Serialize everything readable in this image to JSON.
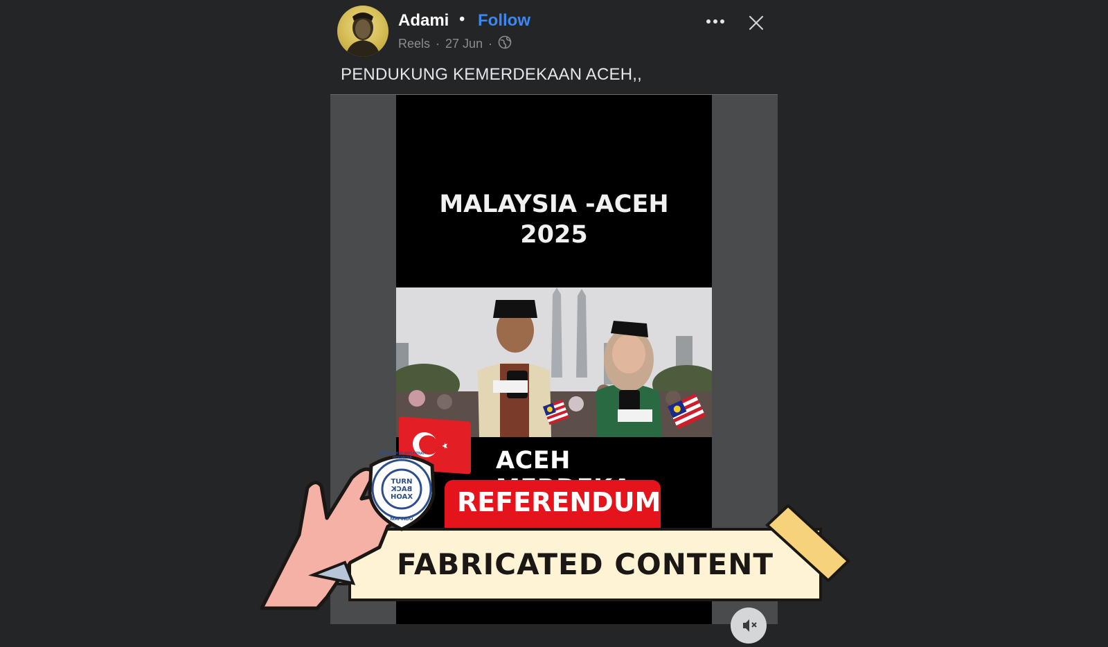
{
  "post": {
    "author": "Adami",
    "separator": "•",
    "follow_label": "Follow",
    "meta_type": "Reels",
    "meta_date": "27 Jun",
    "meta_dot": "·",
    "caption": "PENDUKUNG KEMERDEKAAN ACEH,,"
  },
  "video": {
    "title_line1": "MALAYSIA -ACEH",
    "title_line2": "2025",
    "banner": "ACEH MERDEKA",
    "referendum": "REFERENDUM"
  },
  "stamp": {
    "badge_ring_text": "MASYARAKAT ANTI FITNAH INDONESIA",
    "badge_bottom": "MAFINDO",
    "badge_center": [
      "TURN",
      "BACK",
      "HOAX"
    ],
    "label": "FABRICATED CONTENT"
  },
  "icons": {
    "more": "more-horizontal-icon",
    "close": "close-icon",
    "globe": "globe-icon",
    "mute": "mute-icon"
  }
}
